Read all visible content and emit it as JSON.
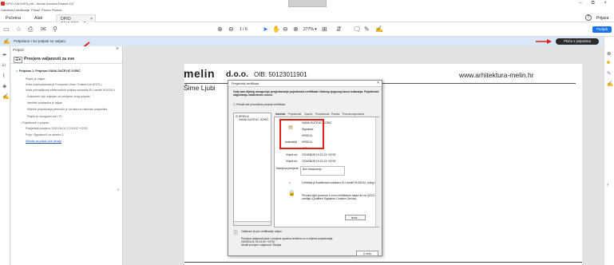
{
  "window": {
    "title": "DPIO ZAHVATA.pdf - Adobe Acrobat Reader DC",
    "controls": "– ⧉ ×"
  },
  "menu": [
    "Datoteka",
    "Uređivanje",
    "Prikaz",
    "Prozor",
    "Pomoć"
  ],
  "tabs": {
    "home": "Početna",
    "tools": "Alati",
    "doc": "DPIO ZAHVATA.pdf",
    "doc_close": "×"
  },
  "header_right": {
    "help": "?",
    "signin": "Prijava",
    "share": "Podijeli"
  },
  "toolbar": {
    "page_current": "1",
    "page_total": "/ 6",
    "zoom": "277%"
  },
  "sigbar": {
    "text": "Potpisano i svi potpisi su valjani.",
    "button": "Ploča s potpisima"
  },
  "sigpanel": {
    "title": "Potpisi",
    "verify_all": "Provjera valjanosti za sve",
    "items": [
      {
        "text": "Potpisao 1: Potpisao IVANA SUČEVIĆ SORIĆ",
        "bold": true
      },
      {
        "text": "Potpis je valjan:"
      },
      {
        "text": "Vrsta potpisa/pečata je European Union Trusted List (EUTL)."
      },
      {
        "text": "Vrsta prihvatljivosti elektroničkih potpisa sukladna EU uredbi 910/2014"
      },
      {
        "text": "Dokument nije mijenjan od primjene ovog potpisa"
      },
      {
        "text": "Identitet potpisnika je valjan"
      },
      {
        "text": "Vrijeme potpisivanja preuzeto je sa sata na računalu potpisnika."
      },
      {
        "text": "Potpis je omogućen za LTV"
      },
      {
        "text": "Pojedinosti o potpisu",
        "caret": true
      },
      {
        "text": "Posljednja provjera: 2020.04.01 17:00:02 +02'00'"
      },
      {
        "text": "Polje: Signature3 na stranici 1"
      },
      {
        "text": "Kliknite za prikaz ove verzije",
        "link": true
      }
    ]
  },
  "document": {
    "company": "melin",
    "company_suffix": "d.o.o.",
    "oib": "OIB: 50123011901",
    "website": "www.arhitektura-melin.hr",
    "name_fragment": "Šime Ljubi"
  },
  "dialog": {
    "title": "Preglednik certifikata",
    "intro": "Ovaj vam dijalog omogućuje pregledavanje pojedinosti certifikata i čitavog njegovog lanca izdavanja. Pojedinosti odgovaraju odabranom unosu.",
    "checkbox": "Prikaži sve pronađene putanje certifikata",
    "tree": [
      "HRIDCA",
      "IVANA SUČEVIĆ SORIĆ"
    ],
    "tabs": [
      "Sažetak",
      "Pojedinosti",
      "Opoziv",
      "Pouzdanost",
      "Pravila",
      "Pravna napomena"
    ],
    "subject_values": [
      "IVANA SUČEVIĆ SORIĆ",
      "Signature",
      "HRIDCA"
    ],
    "issuer_label": "Izdavatelj:",
    "issuer_values": [
      "HRIDCA",
      "AKD d.o.o."
    ],
    "valid_from_label": "Vrijedi od:",
    "valid_from": "2019/08/28 19:22:23 +02'00'",
    "valid_to_label": "Vrijedi do:",
    "valid_to": "2024/08/28 19:22:23 +02'00'",
    "usage_label": "Namjena primjene:",
    "usage": "Bez odbacivanja",
    "eu_text": "Certifikat je kvalificirani sukladno EU uredbi 910/2014, prilog I",
    "qscd_text": "Privatni ključ povezan s ovim certifikatom nalazi se na QSCD uređaju (Qualified Signature Creation Device).",
    "export_button": "Izvoz...",
    "valid_text": "Odabrani je put certifikacije valjan.",
    "validity_check": "Provjera valjanosti puta i provjera opoziva izvršena su s vrijeme potpisivanja:",
    "check_time": "2020/01/11 19:12:01 +01'00'",
    "model": "Model provjere valjanosti: Školjka",
    "ok_button": "U redu",
    "close": "×"
  },
  "colors": {
    "accent_blue": "#1a73e8",
    "highlight_red": "#e2211c",
    "sig_bar": "#d8e8f6"
  }
}
